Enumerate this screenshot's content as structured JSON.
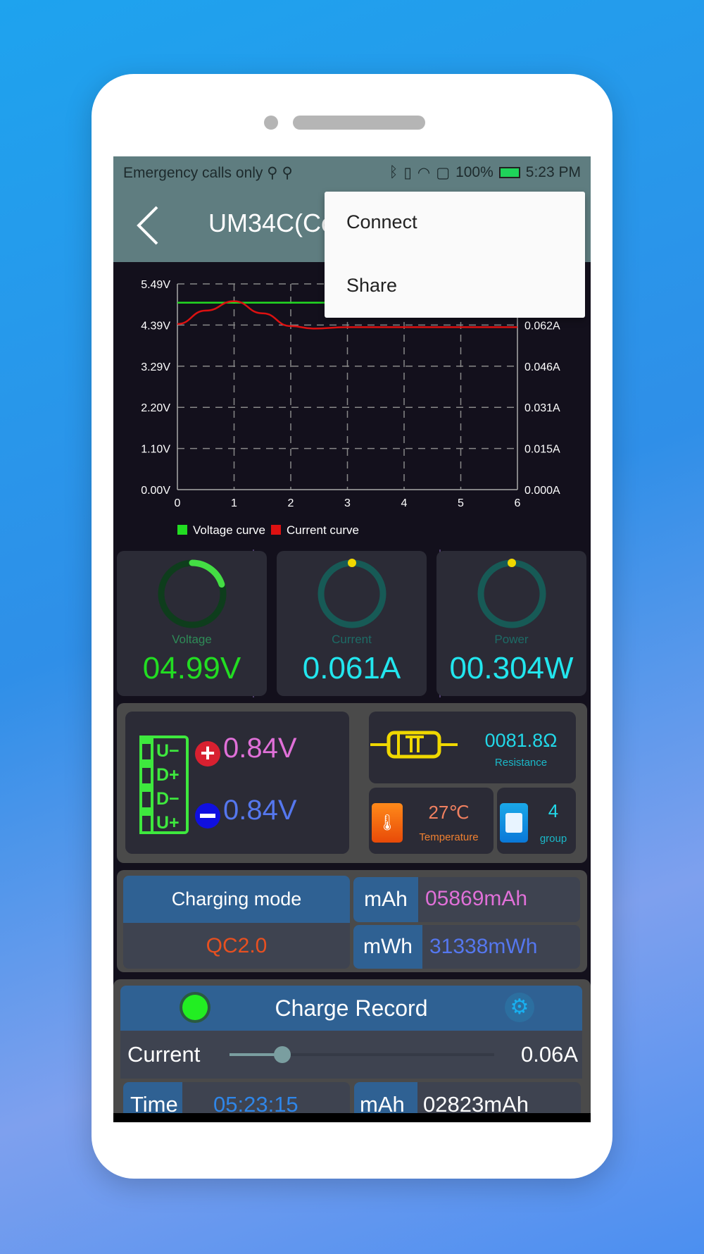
{
  "status_bar": {
    "left_text": "Emergency calls only",
    "usb_icons": [
      "usb-icon",
      "usb-icon"
    ],
    "battery": "100%",
    "time": "5:23 PM",
    "icons": [
      "bluetooth-icon",
      "vibrate-icon",
      "wifi-icon",
      "sim-alert-icon",
      "battery-charging-icon"
    ]
  },
  "app_bar": {
    "title": "UM34C(Co",
    "back_icon": "chevron-left-icon"
  },
  "menu": {
    "items": [
      "Connect",
      "Share"
    ]
  },
  "chart_data": {
    "type": "line",
    "x_ticks": [
      "0",
      "1",
      "2",
      "3",
      "4",
      "5",
      "6"
    ],
    "xlim": [
      0,
      6
    ],
    "y_left_ticks": [
      "0.00V",
      "1.10V",
      "2.20V",
      "3.29V",
      "4.39V",
      "5.49V"
    ],
    "ylim": [
      0,
      5.49
    ],
    "y_right_ticks": [
      "0.000A",
      "0.015A",
      "0.031A",
      "0.046A",
      "0.062A"
    ],
    "y2lim": [
      0,
      0.077
    ],
    "grid": true,
    "legend_placement": "bottom",
    "series": [
      {
        "name": "Voltage curve",
        "axis": "left",
        "color": "#22dd22",
        "points": [
          [
            0,
            4.99
          ],
          [
            1,
            4.99
          ],
          [
            2,
            4.99
          ],
          [
            3,
            4.99
          ],
          [
            4,
            4.99
          ],
          [
            5,
            4.99
          ],
          [
            6,
            4.99
          ]
        ]
      },
      {
        "name": "Current curve",
        "axis": "right",
        "color": "#dd1111",
        "points": [
          [
            0,
            0.062
          ],
          [
            0.5,
            0.067
          ],
          [
            1,
            0.0705
          ],
          [
            1.5,
            0.066
          ],
          [
            2,
            0.0612
          ],
          [
            2.4,
            0.0603
          ],
          [
            3,
            0.0608
          ],
          [
            4,
            0.0608
          ],
          [
            5,
            0.0608
          ],
          [
            6,
            0.0608
          ]
        ]
      }
    ]
  },
  "gauges": [
    {
      "label": "Voltage",
      "value": "04.99V",
      "fraction": 0.2,
      "label_color": "#2e8b57",
      "value_color": "#22dd22",
      "ring": "#0e3d1c",
      "arc": "#44dd44"
    },
    {
      "label": "Current",
      "value": "0.061A",
      "fraction": 0,
      "label_color": "#1d6b66",
      "value_color": "#22e6ee",
      "ring": "#175a56",
      "arc": "#f0d800"
    },
    {
      "label": "Power",
      "value": "00.304W",
      "fraction": 0,
      "label_color": "#1d6b66",
      "value_color": "#22e6ee",
      "ring": "#175a56",
      "arc": "#f0d800"
    }
  ],
  "port": {
    "pins": [
      "U−",
      "D+",
      "D−",
      "U+"
    ],
    "dplus": "0.84V",
    "dminus": "0.84V",
    "plus_color": "#e070d8",
    "minus_color": "#5577ee"
  },
  "resistance": {
    "value": "0081.8Ω",
    "label": "Resistance"
  },
  "temperature": {
    "value": "27℃",
    "label": "Temperature"
  },
  "group": {
    "value": "4",
    "label": "group"
  },
  "energy": {
    "mode_label": "Charging mode",
    "mode_value": "QC2.0",
    "mah_label": "mAh",
    "mah_value": "05869mAh",
    "mwh_label": "mWh",
    "mwh_value": "31338mWh"
  },
  "record": {
    "title": "Charge Record",
    "current_label": "Current",
    "current_value": "0.06A",
    "slider_fraction": 0.2,
    "time_label": "Time",
    "time_value": "05:23:15",
    "mah_label": "mAh",
    "mah_value": "02823mAh"
  }
}
